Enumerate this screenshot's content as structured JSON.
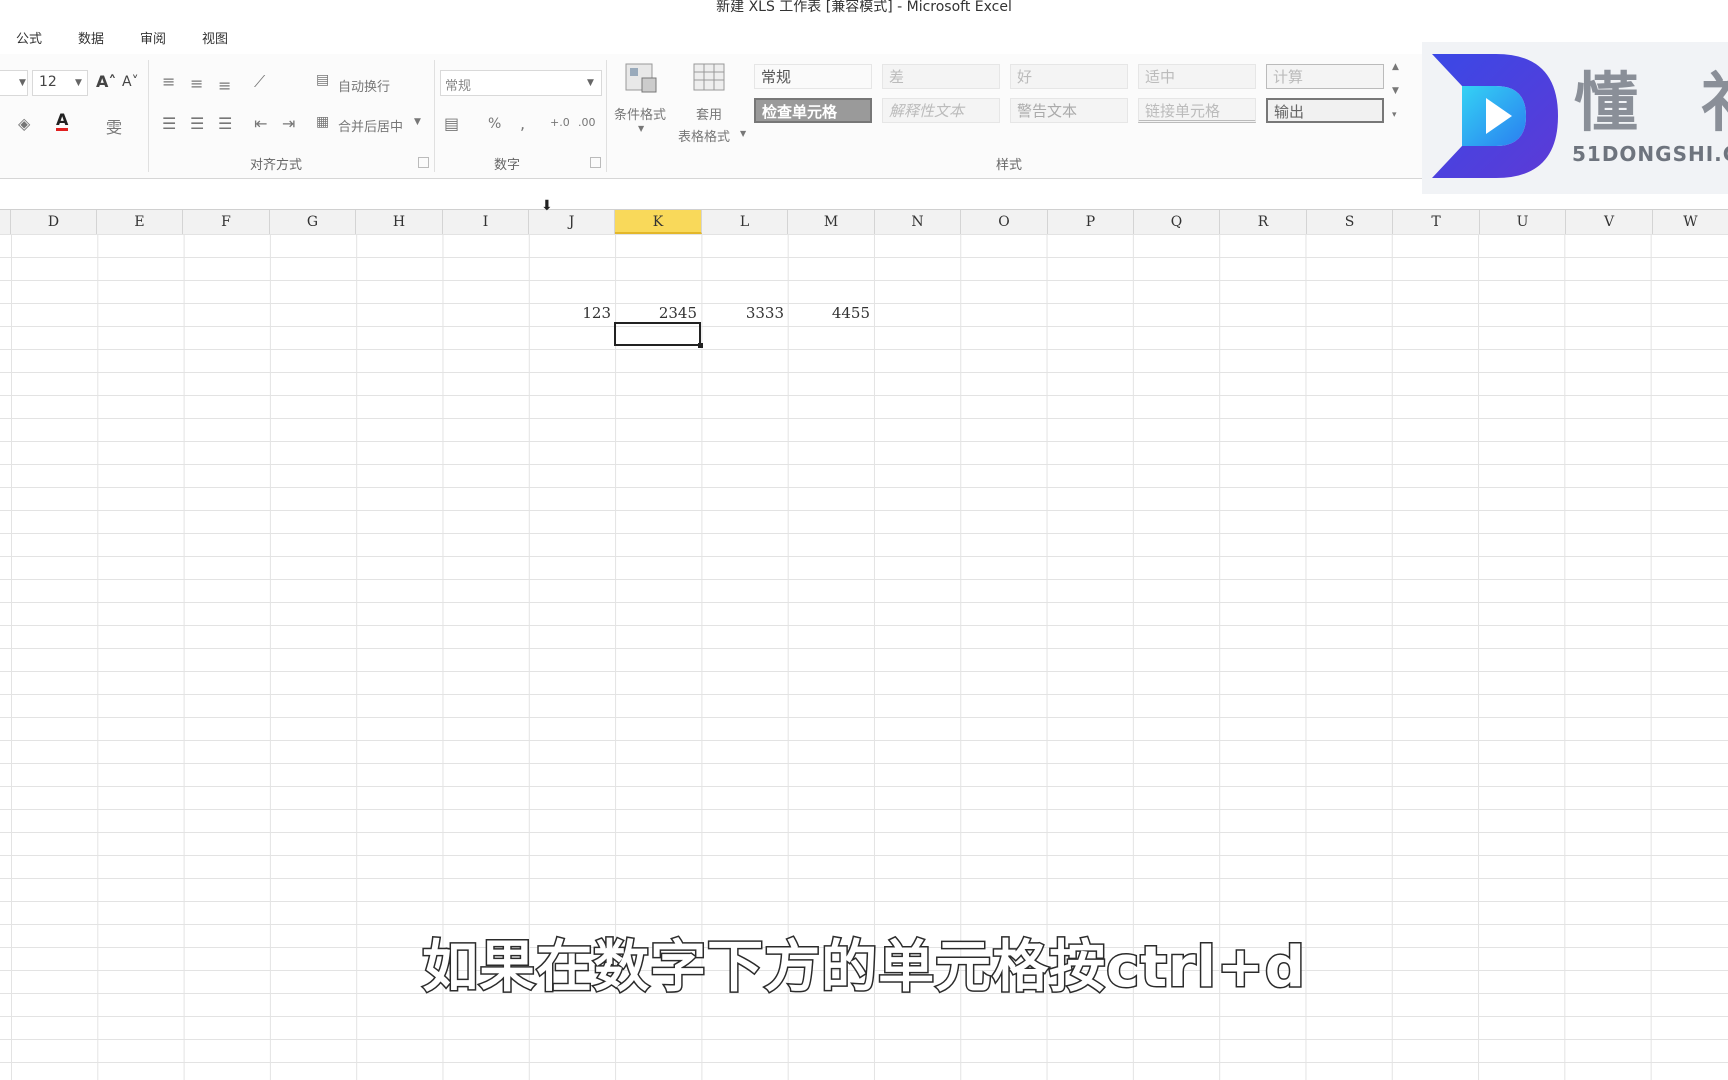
{
  "window": {
    "title": "新建 XLS 工作表 [兼容模式] - Microsoft Excel"
  },
  "menu": {
    "items": [
      "公式",
      "数据",
      "审阅",
      "视图"
    ]
  },
  "ribbon": {
    "font": {
      "size": "12",
      "grow_glyph": "A˄",
      "shrink_glyph": "A˅",
      "color_glyph": "A",
      "pinyin_glyph": "雯"
    },
    "alignment": {
      "wrap_label": "自动换行",
      "merge_label": "合并后居中",
      "group_label": "对齐方式"
    },
    "number": {
      "format_value": "常规",
      "percent": "%",
      "comma": ",",
      "inc_decimal": "+.0",
      "dec_decimal": ".00",
      "group_label": "数字"
    },
    "styles": {
      "cond_format": "条件格式",
      "table_format_1": "套用",
      "table_format_2": "表格格式",
      "cells_row1": [
        "常规",
        "差",
        "好",
        "适中",
        "计算"
      ],
      "cells_row2": [
        "检查单元格",
        "解释性文本",
        "警告文本",
        "链接单元格",
        "输出"
      ],
      "group_label": "样式"
    }
  },
  "logo": {
    "name_visible": "懂 祁",
    "domain": "51DONGSHI.C"
  },
  "columns": [
    "D",
    "E",
    "F",
    "G",
    "H",
    "I",
    "J",
    "K",
    "L",
    "M",
    "N",
    "O",
    "P",
    "Q",
    "R",
    "S",
    "T",
    "U",
    "V",
    "W"
  ],
  "selected_column": "K",
  "cells": [
    {
      "col": "J",
      "value": "123"
    },
    {
      "col": "K",
      "value": "2345"
    },
    {
      "col": "L",
      "value": "3333"
    },
    {
      "col": "M",
      "value": "4455"
    }
  ],
  "subtitle": "如果在数字下方的单元格按ctrl+d",
  "colors": {
    "accent_selected_col": "#f9d95a",
    "logo_blue": "#3b4fe0",
    "logo_cyan": "#27c0f0"
  }
}
